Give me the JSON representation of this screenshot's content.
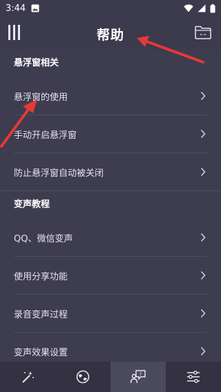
{
  "status_bar": {
    "time": "3:44"
  },
  "header": {
    "title": "帮助"
  },
  "sections": [
    {
      "title": "悬浮窗相关",
      "items": [
        {
          "label": "悬浮窗的使用"
        },
        {
          "label": "手动开启悬浮窗"
        },
        {
          "label": "防止悬浮窗自动被关闭"
        }
      ]
    },
    {
      "title": "变声教程",
      "items": [
        {
          "label": "QQ、微信变声"
        },
        {
          "label": "使用分享功能"
        },
        {
          "label": "录音变声过程"
        },
        {
          "label": "变声效果设置"
        }
      ]
    }
  ],
  "tabs": [
    {
      "icon": "magic-wand-icon"
    },
    {
      "icon": "globe-voice-icon"
    },
    {
      "icon": "help-chat-icon",
      "active": true
    },
    {
      "icon": "sliders-icon"
    }
  ],
  "colors": {
    "background": "#3e3c4f",
    "header": "#3c3a4d",
    "tabbar": "#333142",
    "tab_active": "#4b495c",
    "annotation_arrow": "#e53935"
  }
}
